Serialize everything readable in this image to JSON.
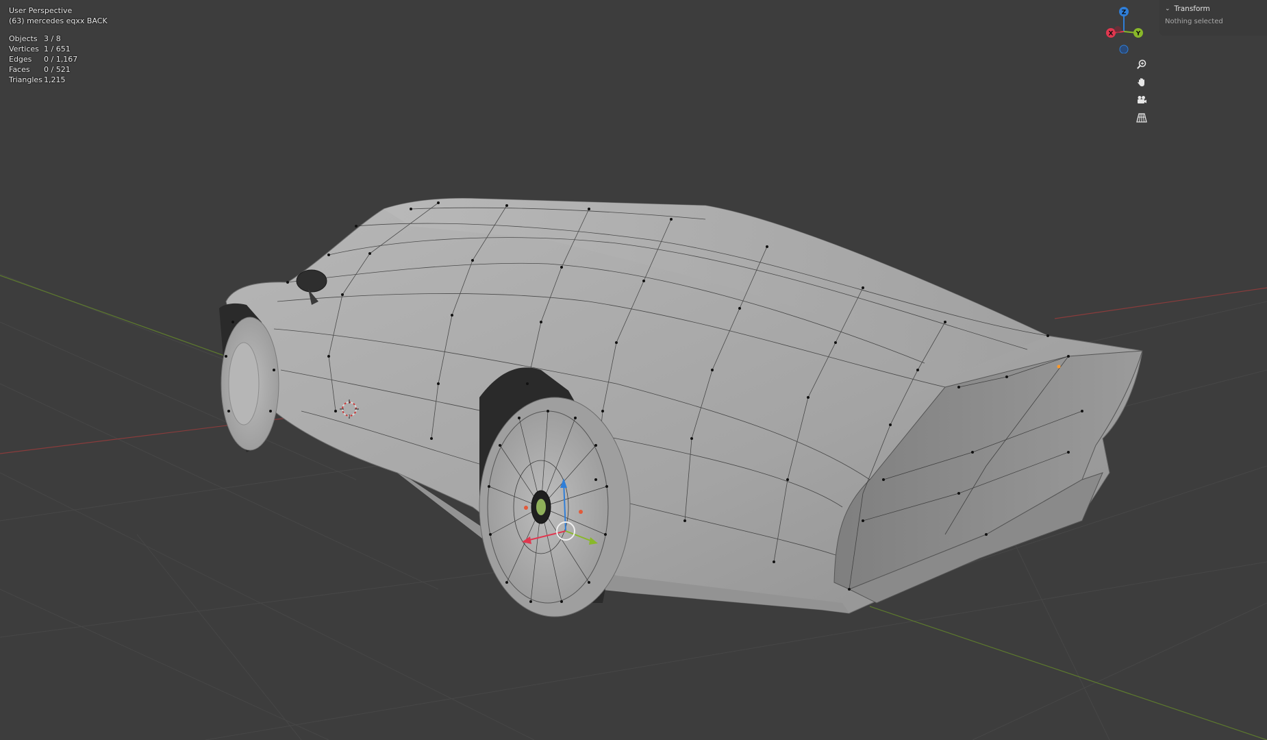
{
  "viewport": {
    "view_name": "User Perspective",
    "object_label": "(63) mercedes eqxx  BACK"
  },
  "stats": [
    {
      "label": "Objects",
      "value": "3 / 8"
    },
    {
      "label": "Vertices",
      "value": "1 / 651"
    },
    {
      "label": "Edges",
      "value": "0 / 1,167"
    },
    {
      "label": "Faces",
      "value": "0 / 521"
    },
    {
      "label": "Triangles",
      "value": "1,215"
    }
  ],
  "gizmo": {
    "z_label": "Z",
    "x_label": "X",
    "y_label": "Y",
    "colors": {
      "x": "#e0374f",
      "y": "#89b82a",
      "z": "#2f7ed8"
    }
  },
  "nav_buttons": [
    {
      "icon": "zoom-icon"
    },
    {
      "icon": "pan-hand-icon"
    },
    {
      "icon": "camera-icon"
    },
    {
      "icon": "perspective-grid-icon"
    }
  ],
  "side_panel": {
    "title": "Transform",
    "body": "Nothing selected"
  },
  "colors": {
    "background": "#3d3d3d",
    "grid": "#474747",
    "x_axis": "#8a3c3c",
    "y_axis": "#5d7a2e",
    "mesh": "#a4a4a4"
  }
}
